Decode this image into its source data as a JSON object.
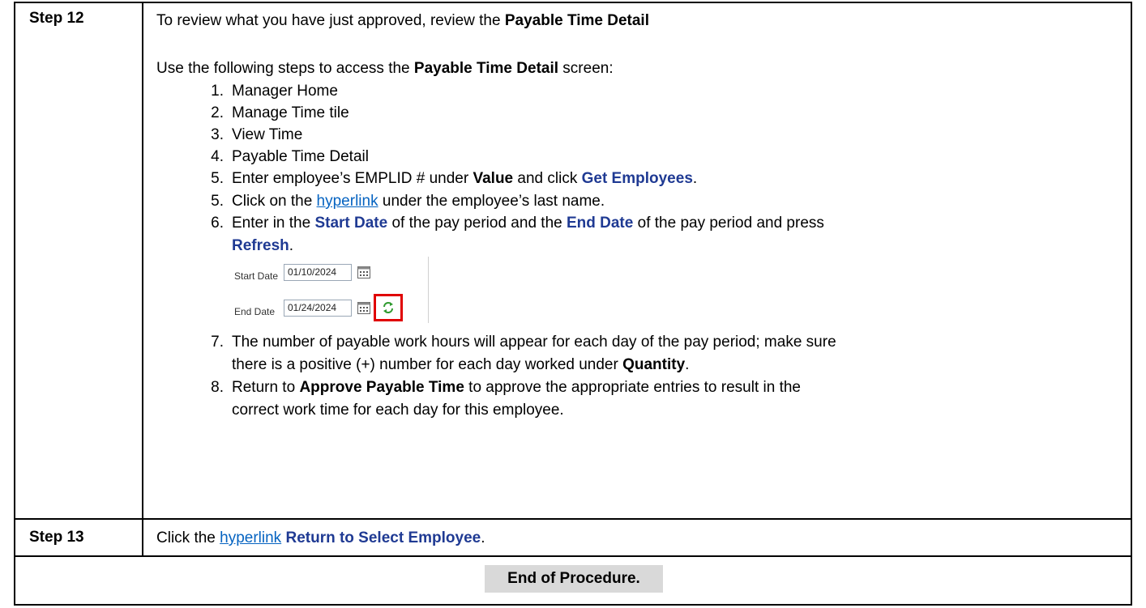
{
  "step12": {
    "label": "Step 12",
    "intro_text": "To review what you have just approved, review the ",
    "intro_bold": "Payable Time Detail",
    "access_text": "Use the following steps to access the ",
    "access_bold": "Payable Time Detail",
    "access_tail": " screen:",
    "items": [
      {
        "num": "1.",
        "text": "Manager Home"
      },
      {
        "num": "2.",
        "text": "Manage Time tile"
      },
      {
        "num": "3.",
        "text": "View Time"
      },
      {
        "num": "4.",
        "text": "Payable Time Detail"
      }
    ],
    "item5a": {
      "num": "5.",
      "t1": "Enter employee’s EMPLID # under ",
      "b1": "Value",
      "t2": " and click ",
      "b2": "Get Employees",
      "t3": "."
    },
    "item5b": {
      "num": "5.",
      "t1": "Click on the ",
      "link": "hyperlink",
      "t2": " under the employee’s last name."
    },
    "item6": {
      "num": "6.",
      "t1": "Enter in the ",
      "b1": "Start Date",
      "t2": " of the pay period and the ",
      "b2": "End Date",
      "t3": " of the pay period and press",
      "b3": "Refresh",
      "t4": "."
    },
    "screenshot": {
      "start_label": "Start Date",
      "start_value": "01/10/2024",
      "end_label": "End Date",
      "end_value": "01/24/2024",
      "calendar_icon": "calendar-icon",
      "refresh_icon": "refresh-icon",
      "highlight_color": "#e00000"
    },
    "item7": {
      "num": "7.",
      "t1": "The number of payable work hours will appear for each day of the pay period; make sure",
      "t2": "there is a positive (+) number for each day worked under ",
      "b1": "Quantity",
      "t3": "."
    },
    "item8": {
      "num": "8.",
      "t1": "Return to ",
      "b1": "Approve Payable Time",
      "t2": " to approve the appropriate entries to result in the",
      "t3": "correct work time for each day for this employee."
    }
  },
  "step13": {
    "label": "Step 13",
    "t1": "Click the ",
    "link": "hyperlink",
    "b1": "Return to Select Employee",
    "t2": "."
  },
  "end": {
    "label": "End of Procedure."
  },
  "colors": {
    "bold_blue": "#1f3a93",
    "link_blue": "#0563c1",
    "end_bg": "#d9d9d9"
  }
}
